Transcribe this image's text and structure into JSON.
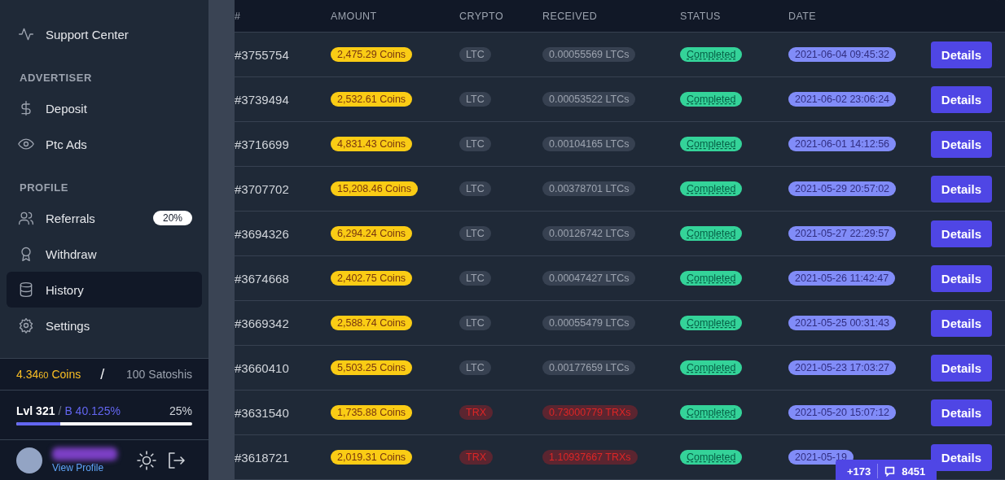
{
  "sidebar": {
    "items": [
      {
        "label": "Support Center",
        "selected": false
      },
      {
        "section": "ADVERTISER"
      },
      {
        "label": "Deposit",
        "selected": false
      },
      {
        "label": "Ptc Ads",
        "selected": false
      },
      {
        "section": "PROFILE"
      },
      {
        "label": "Referrals",
        "selected": false,
        "badge": "20%"
      },
      {
        "label": "Withdraw",
        "selected": false
      },
      {
        "label": "History",
        "selected": true
      },
      {
        "label": "Settings",
        "selected": false
      }
    ],
    "balance": {
      "coins_whole": "4.34",
      "coins_small": "60",
      "coins_unit": "Coins",
      "separator": "/",
      "satoshis": "100 Satoshis"
    },
    "level": {
      "label": "Lvl 321",
      "separator": "/",
      "bonus": "B 40.125%",
      "percent": "25%",
      "level": 0.25
    },
    "profile": {
      "link": "View Profile"
    }
  },
  "table": {
    "columns": [
      "#",
      "AMOUNT",
      "CRYPTO",
      "RECEIVED",
      "STATUS",
      "DATE"
    ],
    "rows": [
      {
        "id": "#3755754",
        "amount": "2,475.29 Coins",
        "crypto": "LTC",
        "kind": "neutral",
        "received": "0.00055569 LTCs",
        "status": "Completed",
        "date": "2021-06-04 09:45:32",
        "action": "Details"
      },
      {
        "id": "#3739494",
        "amount": "2,532.61 Coins",
        "crypto": "LTC",
        "kind": "neutral",
        "received": "0.00053522 LTCs",
        "status": "Completed",
        "date": "2021-06-02 23:06:24",
        "action": "Details"
      },
      {
        "id": "#3716699",
        "amount": "4,831.43 Coins",
        "crypto": "LTC",
        "kind": "neutral",
        "received": "0.00104165 LTCs",
        "status": "Completed",
        "date": "2021-06-01 14:12:56",
        "action": "Details"
      },
      {
        "id": "#3707702",
        "amount": "15,208.46 Coins",
        "crypto": "LTC",
        "kind": "neutral",
        "received": "0.00378701 LTCs",
        "status": "Completed",
        "date": "2021-05-29 20:57:02",
        "action": "Details"
      },
      {
        "id": "#3694326",
        "amount": "6,294.24 Coins",
        "crypto": "LTC",
        "kind": "neutral",
        "received": "0.00126742 LTCs",
        "status": "Completed",
        "date": "2021-05-27 22:29:57",
        "action": "Details"
      },
      {
        "id": "#3674668",
        "amount": "2,402.75 Coins",
        "crypto": "LTC",
        "kind": "neutral",
        "received": "0.00047427 LTCs",
        "status": "Completed",
        "date": "2021-05-26 11:42:47",
        "action": "Details"
      },
      {
        "id": "#3669342",
        "amount": "2,588.74 Coins",
        "crypto": "LTC",
        "kind": "neutral",
        "received": "0.00055479 LTCs",
        "status": "Completed",
        "date": "2021-05-25 00:31:43",
        "action": "Details"
      },
      {
        "id": "#3660410",
        "amount": "5,503.25 Coins",
        "crypto": "LTC",
        "kind": "neutral",
        "received": "0.00177659 LTCs",
        "status": "Completed",
        "date": "2021-05-23 17:03:27",
        "action": "Details"
      },
      {
        "id": "#3631540",
        "amount": "1,735.88 Coins",
        "crypto": "TRX",
        "kind": "danger",
        "received": "0.73000779 TRXs",
        "status": "Completed",
        "date": "2021-05-20 15:07:12",
        "action": "Details"
      },
      {
        "id": "#3618721",
        "amount": "2,019.31 Coins",
        "crypto": "TRX",
        "kind": "danger",
        "received": "1.10937667 TRXs",
        "status": "Completed",
        "date": "2021-05-19",
        "action": "Details"
      }
    ]
  },
  "chat_widget": {
    "online": "+173",
    "messages": "8451"
  }
}
